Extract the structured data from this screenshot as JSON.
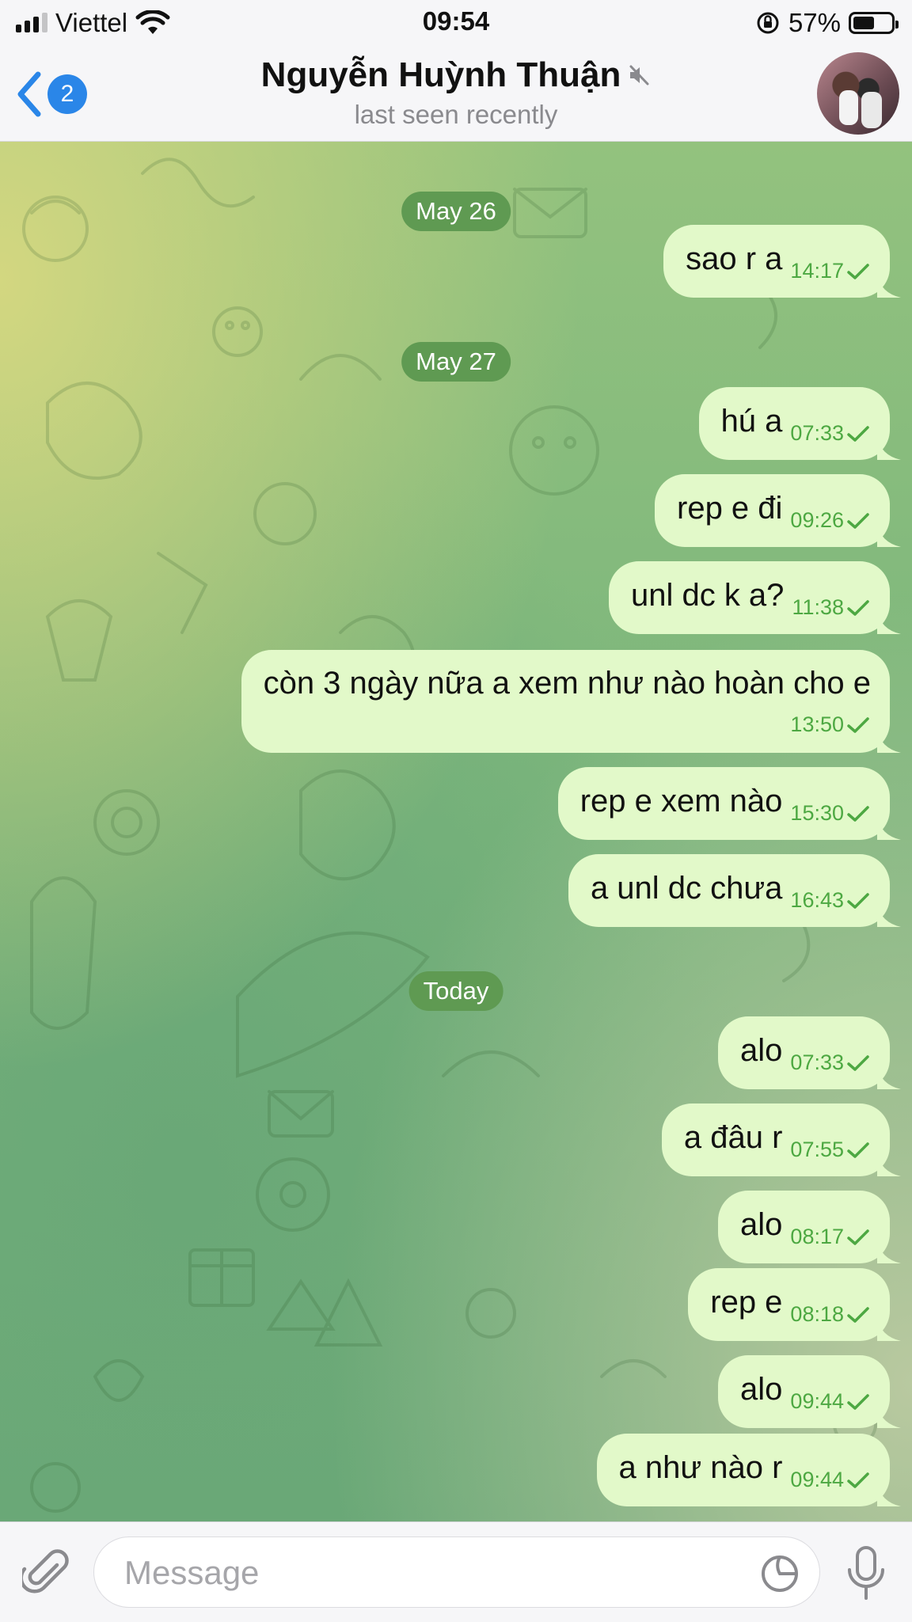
{
  "status_bar": {
    "carrier": "Viettel",
    "time": "09:54",
    "battery_percent": "57%",
    "battery_level": 0.57,
    "signal_bars_filled": 3,
    "icons": [
      "signal-icon",
      "wifi-icon",
      "orientation-lock-icon",
      "battery-icon"
    ]
  },
  "header": {
    "back_badge": "2",
    "contact_name": "Nguyễn Huỳnh Thuận",
    "muted": true,
    "status": "last seen recently"
  },
  "messages": [
    {
      "type": "date",
      "text": "May 26"
    },
    {
      "type": "out",
      "text": "sao r a",
      "time": "14:17"
    },
    {
      "type": "date",
      "text": "May 27"
    },
    {
      "type": "out",
      "text": "hú a",
      "time": "07:33"
    },
    {
      "type": "out",
      "text": "rep e đi",
      "time": "09:26"
    },
    {
      "type": "out",
      "text": "unl dc k a?",
      "time": "11:38"
    },
    {
      "type": "out",
      "text": "còn 3 ngày nữa a xem như nào hoàn cho e",
      "time": "13:50"
    },
    {
      "type": "out",
      "text": "rep e xem nào",
      "time": "15:30"
    },
    {
      "type": "out",
      "text": "a unl dc chưa",
      "time": "16:43"
    },
    {
      "type": "date",
      "text": "Today"
    },
    {
      "type": "out",
      "text": "alo",
      "time": "07:33"
    },
    {
      "type": "out",
      "text": "a đâu r",
      "time": "07:55"
    },
    {
      "type": "out",
      "text": "alo",
      "time": "08:17"
    },
    {
      "type": "out",
      "text": "rep e",
      "time": "08:18"
    },
    {
      "type": "out",
      "text": "alo",
      "time": "09:44"
    },
    {
      "type": "out",
      "text": "a như nào r",
      "time": "09:44"
    }
  ],
  "input": {
    "placeholder": "Message",
    "value": ""
  },
  "colors": {
    "accent": "#2a86e8",
    "bubble_out": "#e2f9c9",
    "check": "#4da842",
    "date_pill": "#5f9a52"
  }
}
